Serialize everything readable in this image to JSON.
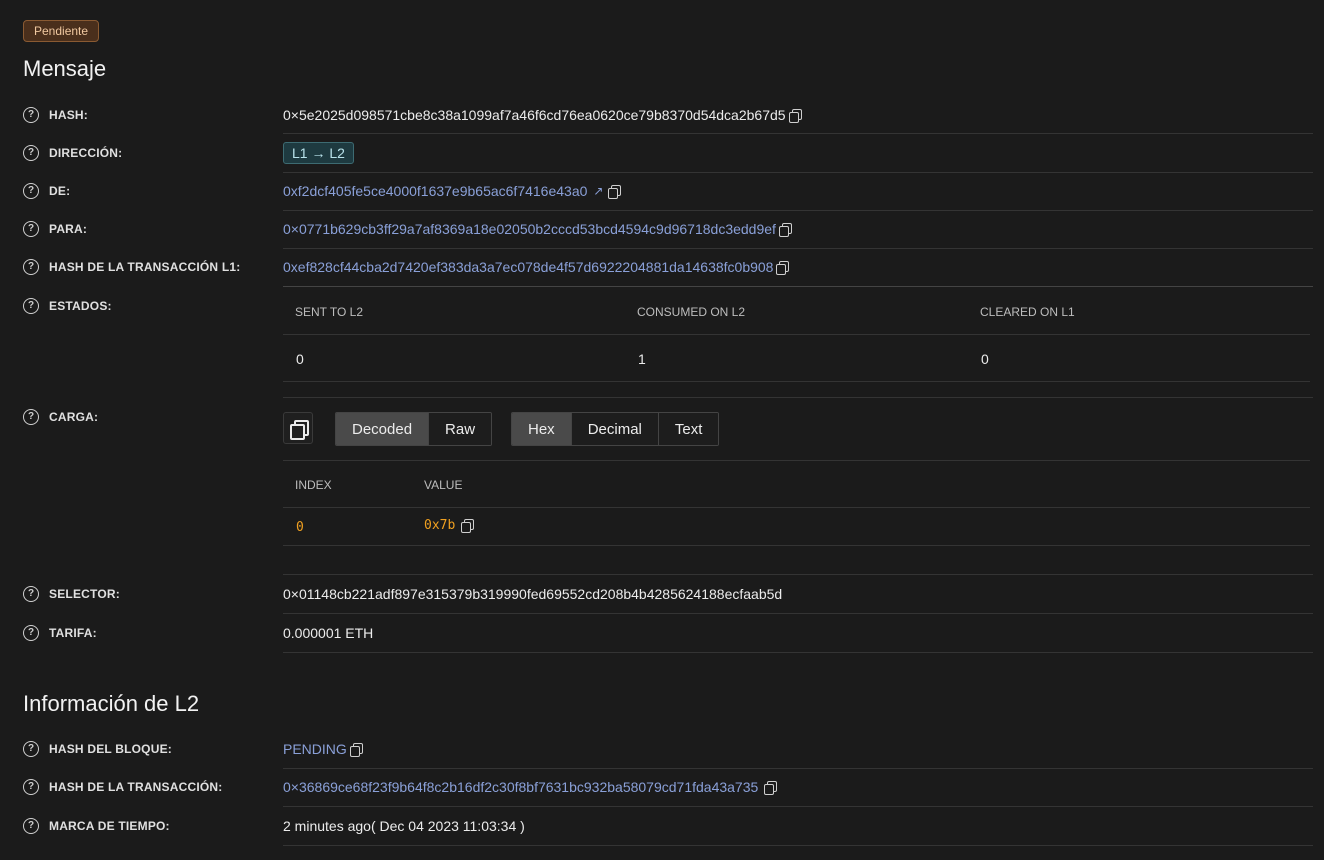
{
  "status_badge": "Pendiente",
  "sections": {
    "message_title": "Mensaje",
    "l2_title": "Información de L2"
  },
  "fields": {
    "hash": {
      "label": "HASH:",
      "value": "0×5e2025d098571cbe8c38a1099af7a46f6cd76ea0620ce79b8370d54dca2b67d5"
    },
    "direction": {
      "label": "DIRECCIÓN:",
      "value": "L1 → L2"
    },
    "from": {
      "label": "DE:",
      "value": "0xf2dcf405fe5ce4000f1637e9b65ac6f7416e43a0"
    },
    "to": {
      "label": "PARA:",
      "value": "0×0771b629cb3ff29a7af8369a18e02050b2cccd53bcd4594c9d96718dc3edd9ef"
    },
    "l1_tx_hash": {
      "label": "HASH DE LA TRANSACCIÓN L1:",
      "value": "0xef828cf44cba2d7420ef383da3a7ec078de4f57d6922204881da14638fc0b908"
    },
    "states": {
      "label": "ESTADOS:"
    },
    "payload": {
      "label": "CARGA:"
    },
    "selector": {
      "label": "SELECTOR:",
      "value": "0×01148cb221adf897e315379b319990fed69552cd208b4b4285624188ecfaab5d"
    },
    "fee": {
      "label": "TARIFA:",
      "value": "0.000001 ETH"
    },
    "block_hash": {
      "label": "HASH DEL BLOQUE:",
      "value": "PENDING"
    },
    "tx_hash": {
      "label": "HASH DE LA TRANSACCIÓN:",
      "value": "0×36869ce68f23f9b64f8c2b16df2c30f8bf7631bc932ba58079cd71fda43a735"
    },
    "timestamp": {
      "label": "MARCA DE TIEMPO:",
      "value": "2 minutes ago( Dec 04 2023 11:03:34 )"
    }
  },
  "states_table": {
    "columns": [
      "SENT TO L2",
      "CONSUMED ON L2",
      "CLEARED ON L1"
    ],
    "values": [
      "0",
      "1",
      "0"
    ]
  },
  "payload": {
    "view_modes": [
      "Decoded",
      "Raw"
    ],
    "active_view": "Decoded",
    "formats": [
      "Hex",
      "Decimal",
      "Text"
    ],
    "active_format": "Hex",
    "table": {
      "columns": [
        "INDEX",
        "VALUE"
      ],
      "rows": [
        {
          "index": "0",
          "value": "0x7b"
        }
      ]
    }
  }
}
